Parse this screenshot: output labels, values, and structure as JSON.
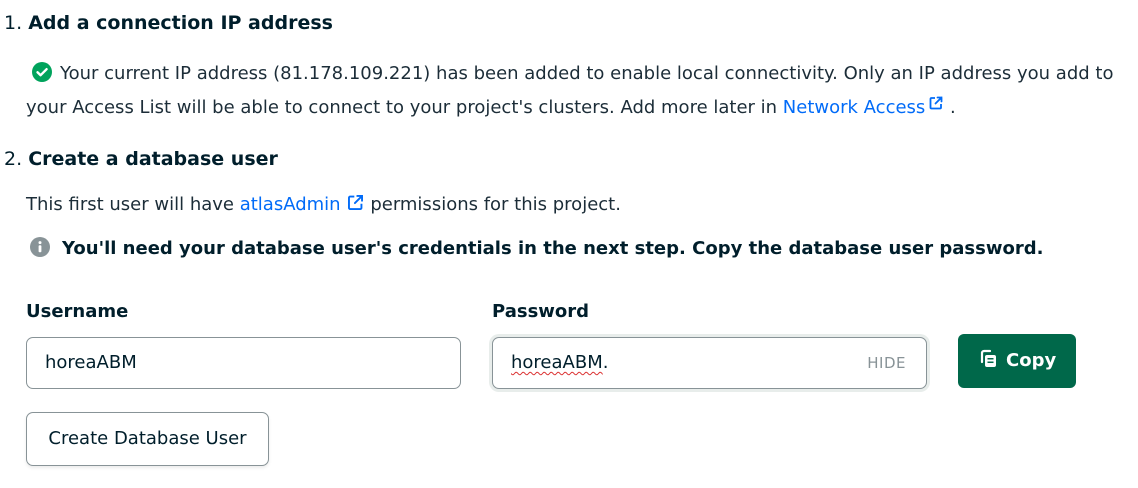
{
  "colors": {
    "link": "#016bf8",
    "success": "#00a35c",
    "primary_button": "#00684a",
    "info_icon": "#889397",
    "spellcheck_underline": "#db3030"
  },
  "step1": {
    "number": "1.",
    "title": "Add a connection IP address",
    "notice_icon": "check-circle-icon",
    "notice_text": "Your current IP address (81.178.109.221) has been added to enable local connectivity. Only an IP address you add to your Access List will be able to connect to your project's clusters. Add more later in ",
    "network_access_link": "Network Access",
    "notice_end": " ."
  },
  "step2": {
    "number": "2.",
    "title": "Create a database user",
    "permission_prefix": "This first user will have ",
    "atlas_admin_link": "atlasAdmin",
    "permission_suffix": " permissions for this project.",
    "warning_icon": "info-icon",
    "warning_text": "You'll need your database user's credentials in the next step. Copy the database user password.",
    "username_label": "Username",
    "username_value": "horeaABM",
    "password_label": "Password",
    "password_value_main": "horeaABM",
    "password_value_tail": ".",
    "hide_label": "HIDE",
    "copy_label": "Copy",
    "copy_icon": "copy-icon",
    "create_button_label": "Create Database User"
  }
}
